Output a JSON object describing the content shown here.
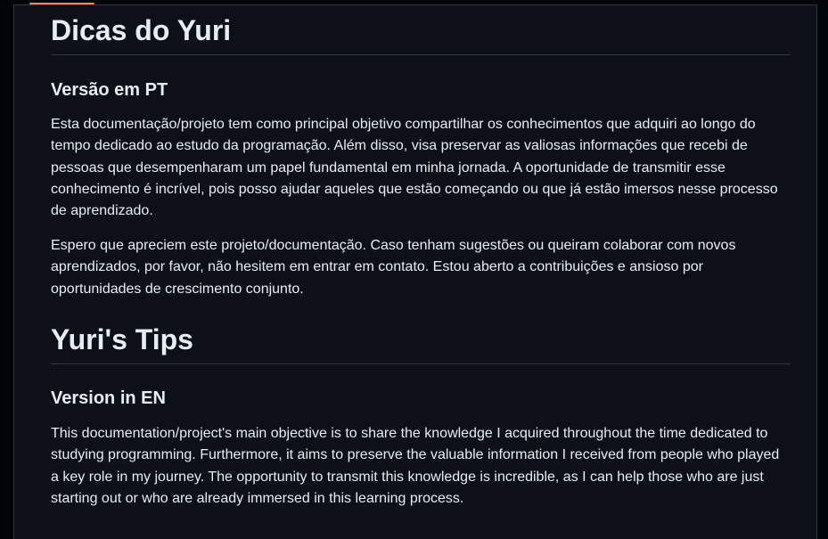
{
  "section_pt": {
    "title": "Dicas do Yuri",
    "subtitle": "Versão em PT",
    "paragraph_1": "Esta documentação/projeto tem como principal objetivo compartilhar os conhecimentos que adquiri ao longo do tempo dedicado ao estudo da programação. Além disso, visa preservar as valiosas informações que recebi de pessoas que desempenharam um papel fundamental em minha jornada. A oportunidade de transmitir esse conhecimento é incrível, pois posso ajudar aqueles que estão começando ou que já estão imersos nesse processo de aprendizado.",
    "paragraph_2": "Espero que apreciem este projeto/documentação. Caso tenham sugestões ou queiram colaborar com novos aprendizados, por favor, não hesitem em entrar em contato. Estou aberto a contribuições e ansioso por oportunidades de crescimento conjunto."
  },
  "section_en": {
    "title": "Yuri's Tips",
    "subtitle": "Version in EN",
    "paragraph_1": "This documentation/project's main objective is to share the knowledge I acquired throughout the time dedicated to studying programming. Furthermore, it aims to preserve the valuable information I received from people who played a key role in my journey. The opportunity to transmit this knowledge is incredible, as I can help those who are just starting out or who are already immersed in this learning process."
  },
  "colors": {
    "background": "#0d1117",
    "text": "#e6edf3",
    "divider": "#30363d",
    "active_tab_indicator": "#f78166"
  }
}
